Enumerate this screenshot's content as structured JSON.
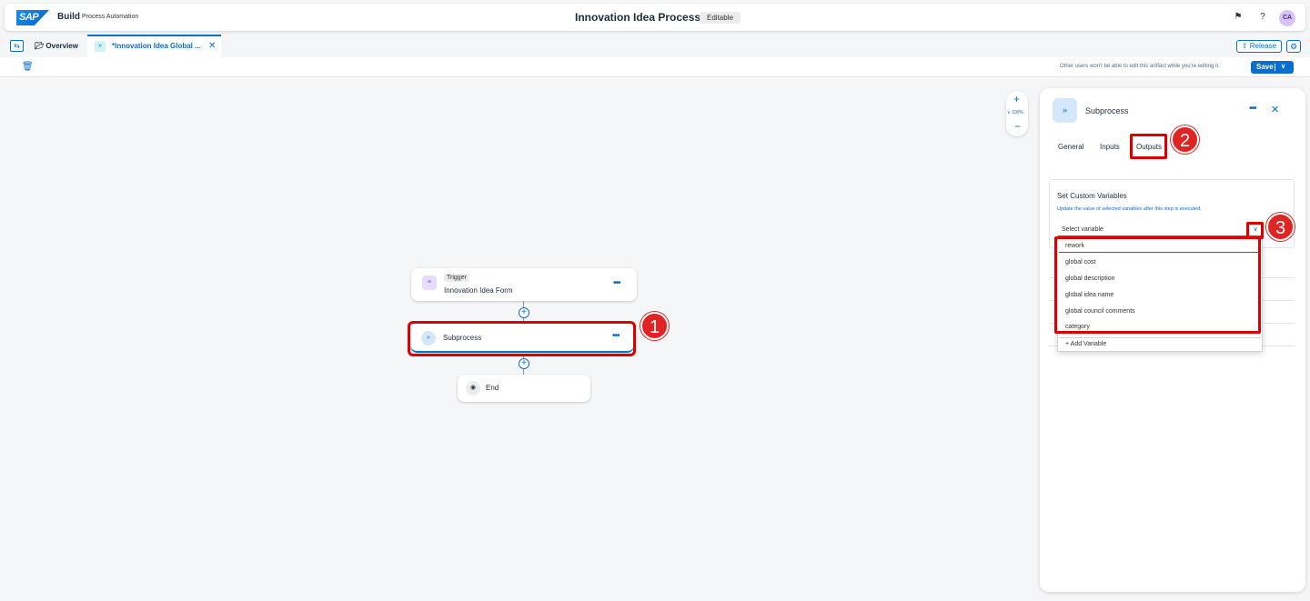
{
  "shell": {
    "brand": "Build",
    "brand_sub": "Process Automation",
    "title": "Innovation Idea Process",
    "status": "Editable",
    "avatar": "CA"
  },
  "tabs": {
    "overview": "Overview",
    "active": "*Innovation Idea Global ...",
    "release": "Release"
  },
  "toolbar": {
    "lock_message": "Other users won't be able to edit this artifact while you're editing it.",
    "save": "Save"
  },
  "zoom": {
    "level": "100%"
  },
  "flow": {
    "trigger_tag": "Trigger",
    "trigger_name": "Innovation Idea Form",
    "subprocess_name": "Subprocess",
    "end_name": "End"
  },
  "panel": {
    "title": "Subprocess",
    "tabs": [
      "General",
      "Inputs",
      "Outputs"
    ],
    "section_title": "Set Custom Variables",
    "section_desc": "Update the value of selected variables after this step is executed.",
    "select_placeholder": "Select variable",
    "options": [
      "rework",
      "global cost",
      "global description",
      "global idea name",
      "global council comments",
      "category"
    ],
    "add_variable": "Add Variable"
  },
  "annotations": [
    "1",
    "2",
    "3"
  ],
  "colors": {
    "accent": "#0a6ed1",
    "highlight": "#dd0000"
  }
}
